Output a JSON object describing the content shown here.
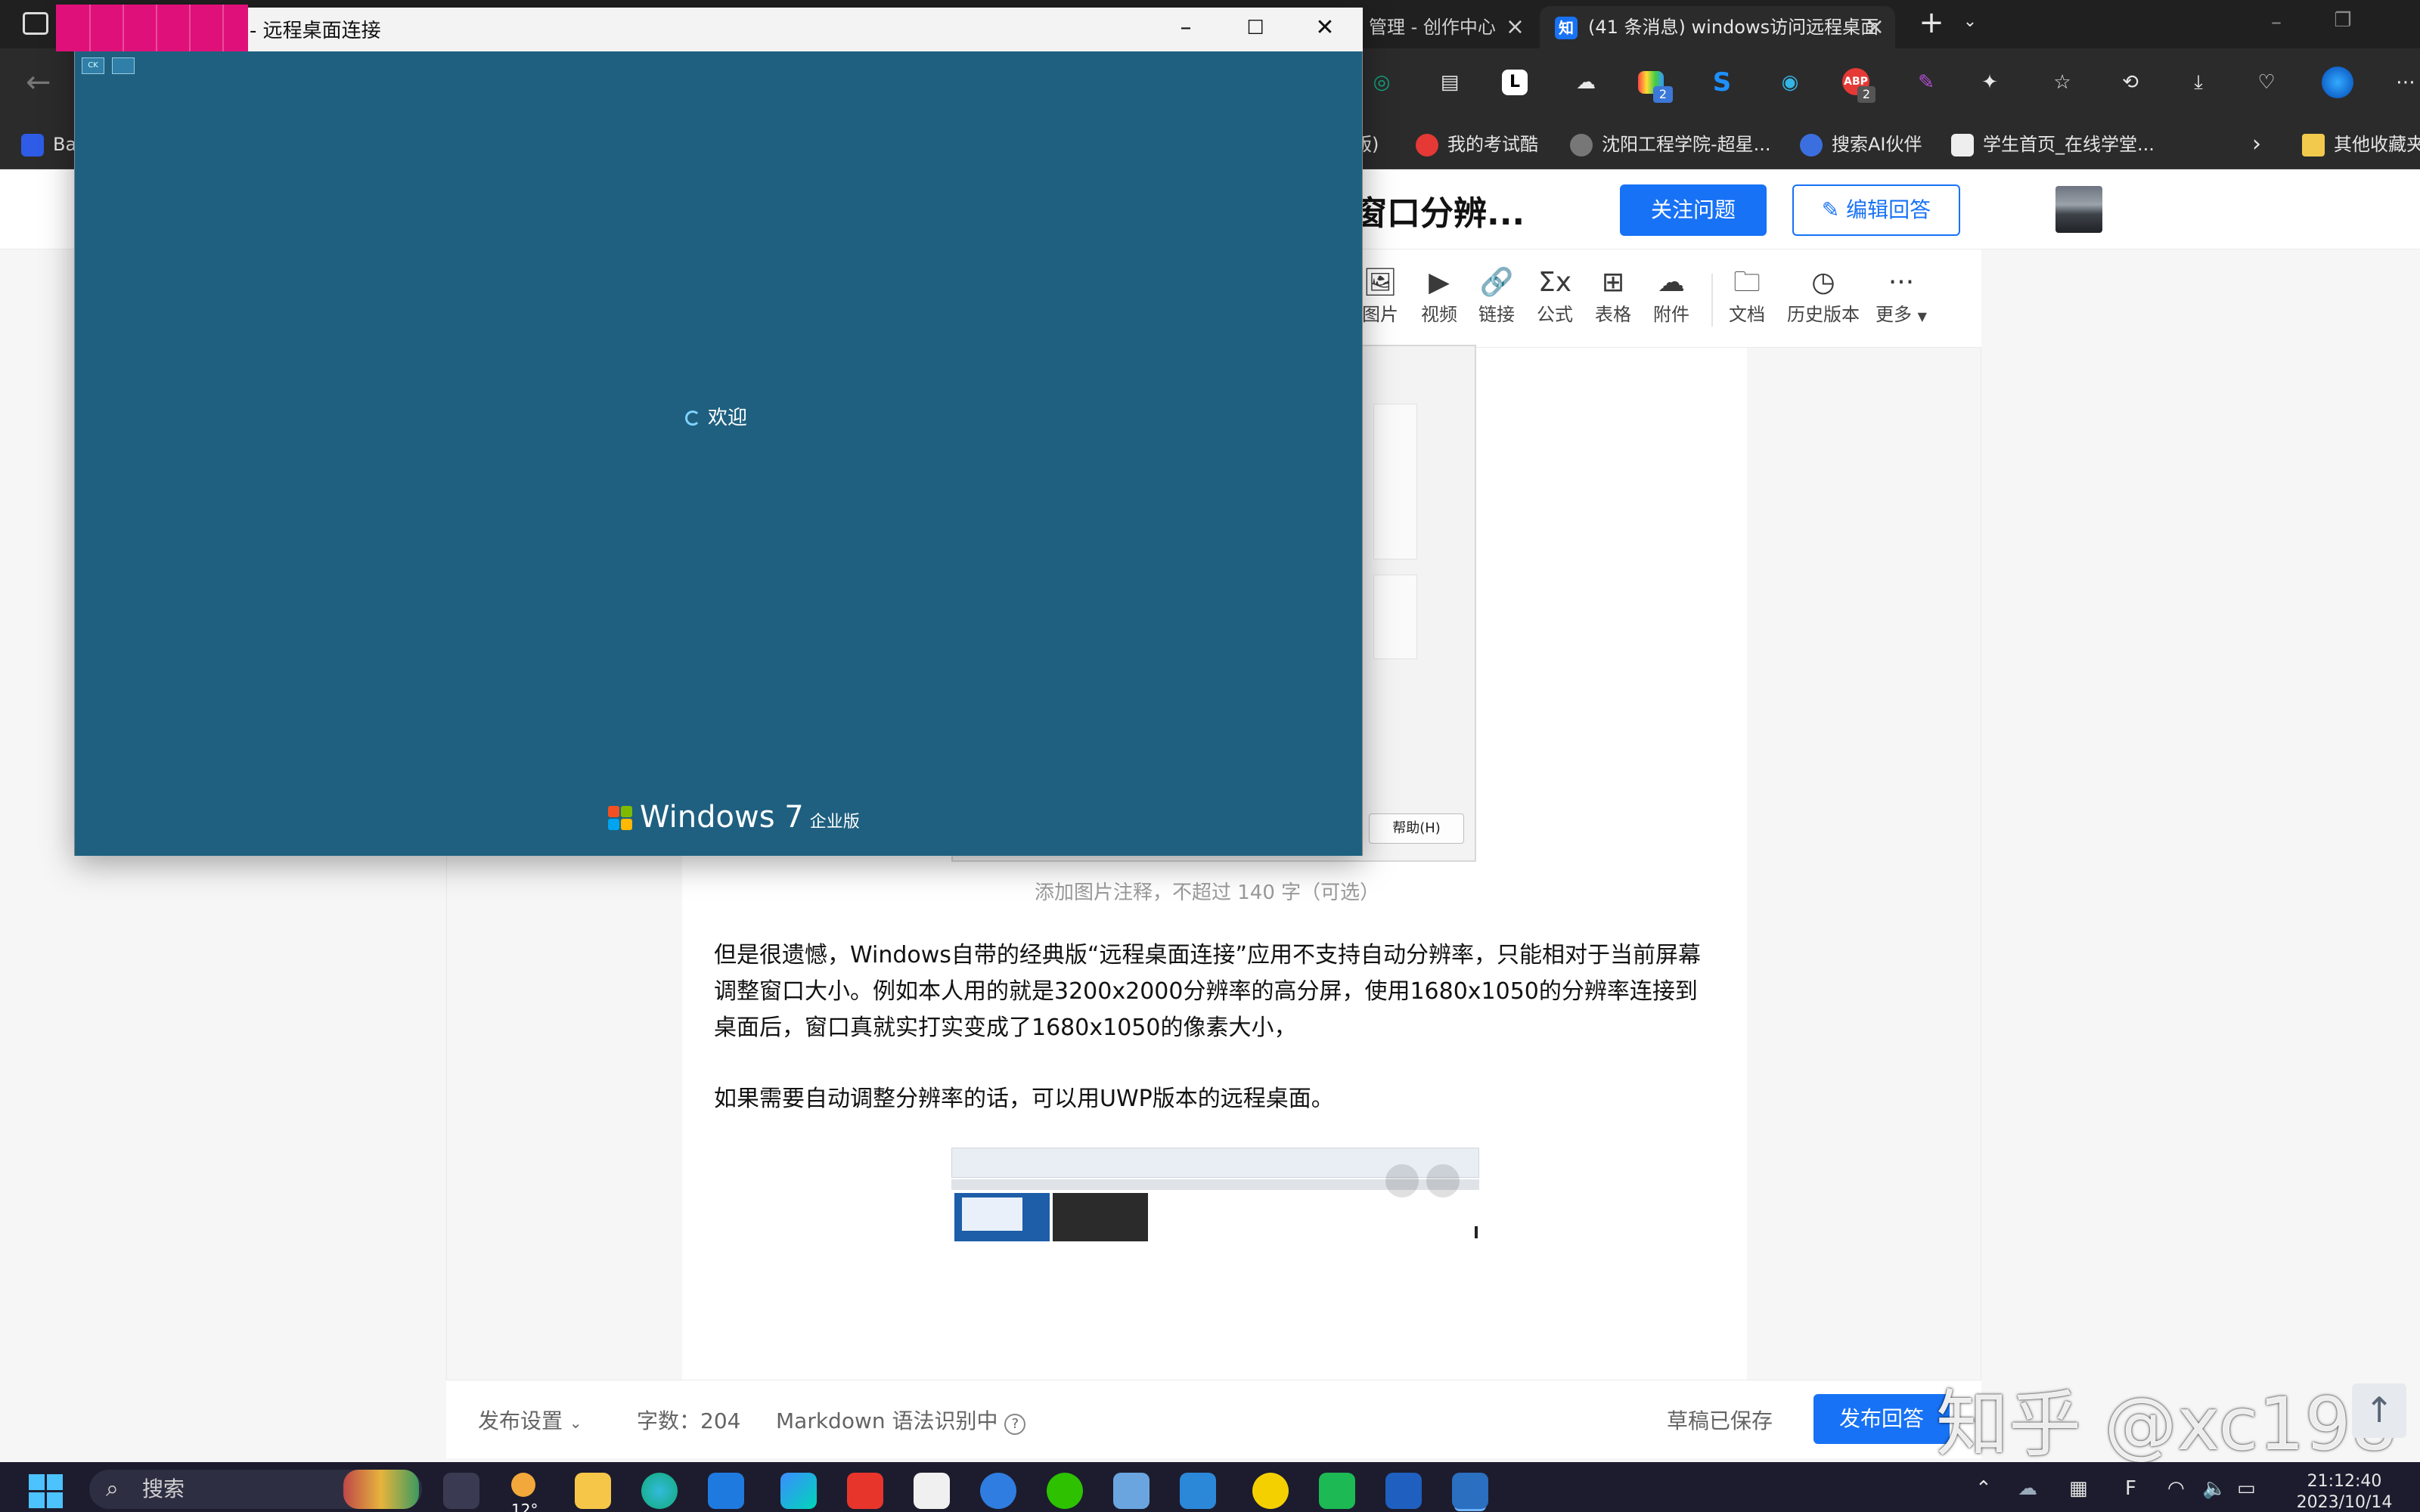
{
  "browser": {
    "tabs": [
      {
        "label": "管理 - 创作中心"
      },
      {
        "label": "(41 条消息) windows访问远程桌面"
      }
    ],
    "new_tab_icon": "plus-icon",
    "bookmarks": [
      {
        "label": "Ba"
      },
      {
        "label": "版)"
      },
      {
        "label": "我的考试酷"
      },
      {
        "label": "沈阳工程学院-超星..."
      },
      {
        "label": "搜索AI伙伴"
      },
      {
        "label": "学生首页_在线学堂..."
      },
      {
        "label": "其他收藏夹"
      }
    ],
    "extension_badges": {
      "first": "2",
      "second": "2"
    }
  },
  "page": {
    "question_title": "窗口分辨...",
    "follow_label": "关注问题",
    "edit_label": "编辑回答",
    "toolbar": [
      {
        "label": "图片",
        "icon": "image-icon"
      },
      {
        "label": "视频",
        "icon": "video-icon"
      },
      {
        "label": "链接",
        "icon": "link-icon"
      },
      {
        "label": "公式",
        "icon": "formula-icon"
      },
      {
        "label": "表格",
        "icon": "table-icon"
      },
      {
        "label": "附件",
        "icon": "cloud-icon"
      },
      {
        "label": "文档",
        "icon": "folder-plus-icon"
      },
      {
        "label": "历史版本",
        "icon": "clock-icon"
      },
      {
        "label": "更多",
        "icon": "more-icon"
      }
    ],
    "embedded_help_button": "帮助(H)",
    "image_caption_placeholder": "添加图片注释，不超过 140 字（可选）",
    "paragraph1": "但是很遗憾，Windows自带的经典版“远程桌面连接”应用不支持自动分辨率，只能相对于当前屏幕调整窗口大小。例如本人用的就是3200x2000分辨率的高分屏，使用1680x1050的分辨率连接到桌面后，窗口真就实打实变成了1680x1050的像素大小，",
    "paragraph2": "如果需要自动调整分辨率的话，可以用UWP版本的远程桌面。",
    "status_bar": {
      "publish_settings": "发布设置",
      "word_count": "字数：204",
      "markdown": "Markdown 语法识别中",
      "draft_saved": "草稿已保存",
      "publish": "发布回答"
    },
    "watermark": "知乎 @xc198"
  },
  "rdp": {
    "title": "- 远程桌面连接",
    "welcome": "欢迎",
    "os_name": "Windows 7",
    "edition": "企业版",
    "bg_color": "#1f6080"
  },
  "taskbar": {
    "search_placeholder": "搜索",
    "weather": "12°",
    "ime": "F",
    "time": "21:12:40",
    "date": "2023/10/14"
  }
}
